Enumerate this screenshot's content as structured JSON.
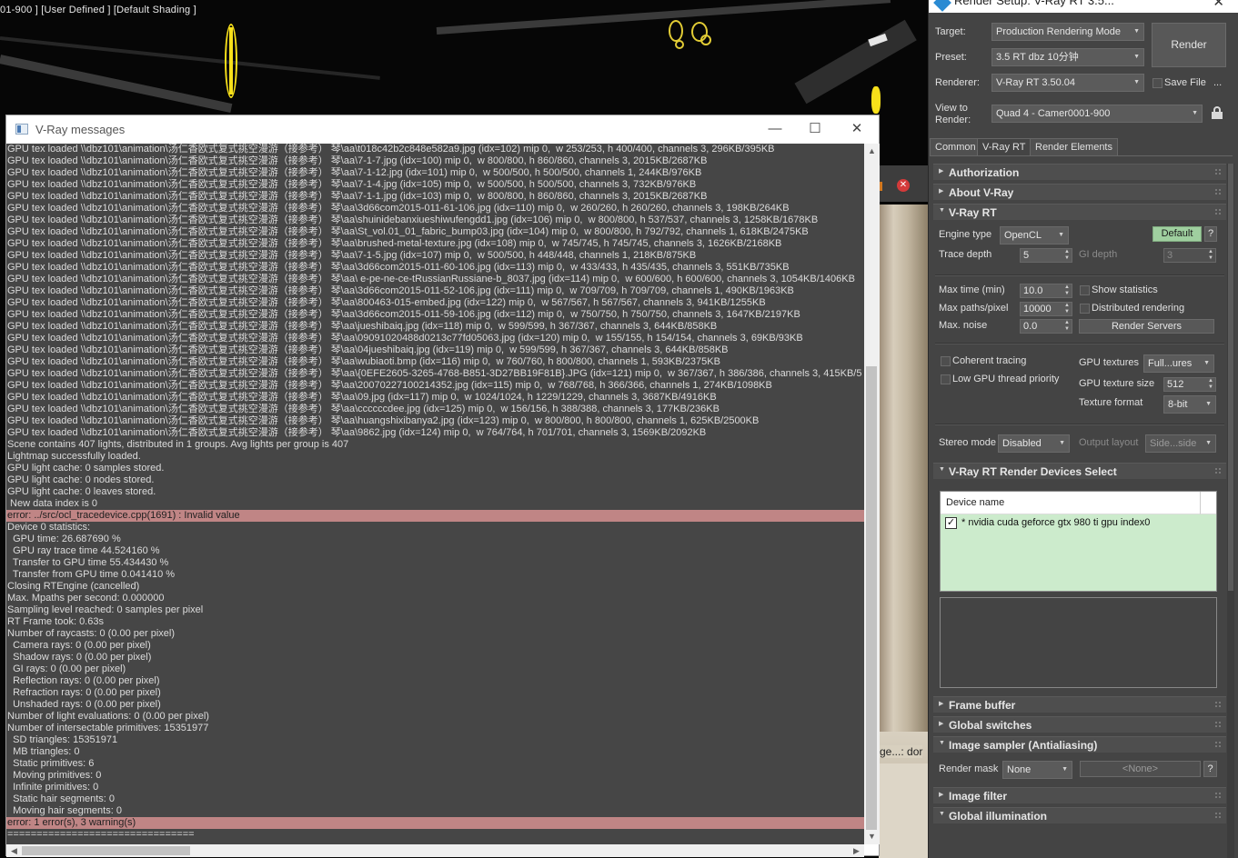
{
  "viewport": {
    "label": "01-900 ] [User Defined ] [Default Shading ]",
    "fragment_text": "ge...: dor"
  },
  "messages_window": {
    "title": "V-Ray messages",
    "lines": [
      {
        "text": "GPU tex loaded \\\\dbz101\\animation\\汤仁香欧式复式挑空漫游（接参考） 琴\\aa\\t018c42b2c848e582a9.jpg (idx=102) mip 0,  w 253/253, h 400/400, channels 3, 296KB/395KB",
        "error": false
      },
      {
        "text": "GPU tex loaded \\\\dbz101\\animation\\汤仁香欧式复式挑空漫游（接参考） 琴\\aa\\7-1-7.jpg (idx=100) mip 0,  w 800/800, h 860/860, channels 3, 2015KB/2687KB",
        "error": false
      },
      {
        "text": "GPU tex loaded \\\\dbz101\\animation\\汤仁香欧式复式挑空漫游（接参考） 琴\\aa\\7-1-12.jpg (idx=101) mip 0,  w 500/500, h 500/500, channels 1, 244KB/976KB",
        "error": false
      },
      {
        "text": "GPU tex loaded \\\\dbz101\\animation\\汤仁香欧式复式挑空漫游（接参考） 琴\\aa\\7-1-4.jpg (idx=105) mip 0,  w 500/500, h 500/500, channels 3, 732KB/976KB",
        "error": false
      },
      {
        "text": "GPU tex loaded \\\\dbz101\\animation\\汤仁香欧式复式挑空漫游（接参考） 琴\\aa\\7-1-1.jpg (idx=103) mip 0,  w 800/800, h 860/860, channels 3, 2015KB/2687KB",
        "error": false
      },
      {
        "text": "GPU tex loaded \\\\dbz101\\animation\\汤仁香欧式复式挑空漫游（接参考） 琴\\aa\\3d66com2015-011-61-106.jpg (idx=110) mip 0,  w 260/260, h 260/260, channels 3, 198KB/264KB",
        "error": false
      },
      {
        "text": "GPU tex loaded \\\\dbz101\\animation\\汤仁香欧式复式挑空漫游（接参考） 琴\\aa\\shuinidebanxiueshiwufengdd1.jpg (idx=106) mip 0,  w 800/800, h 537/537, channels 3, 1258KB/1678KB",
        "error": false
      },
      {
        "text": "GPU tex loaded \\\\dbz101\\animation\\汤仁香欧式复式挑空漫游（接参考） 琴\\aa\\St_vol.01_01_fabric_bump03.jpg (idx=104) mip 0,  w 800/800, h 792/792, channels 1, 618KB/2475KB",
        "error": false
      },
      {
        "text": "GPU tex loaded \\\\dbz101\\animation\\汤仁香欧式复式挑空漫游（接参考） 琴\\aa\\brushed-metal-texture.jpg (idx=108) mip 0,  w 745/745, h 745/745, channels 3, 1626KB/2168KB",
        "error": false
      },
      {
        "text": "GPU tex loaded \\\\dbz101\\animation\\汤仁香欧式复式挑空漫游（接参考） 琴\\aa\\7-1-5.jpg (idx=107) mip 0,  w 500/500, h 448/448, channels 1, 218KB/875KB",
        "error": false
      },
      {
        "text": "GPU tex loaded \\\\dbz101\\animation\\汤仁香欧式复式挑空漫游（接参考） 琴\\aa\\3d66com2015-011-60-106.jpg (idx=113) mip 0,  w 433/433, h 435/435, channels 3, 551KB/735KB",
        "error": false
      },
      {
        "text": "GPU tex loaded \\\\dbz101\\animation\\汤仁香欧式复式挑空漫游（接参考） 琴\\aa\\ e-pe-ne-ce-tRussianRussiane-b_8037.jpg (idx=114) mip 0,  w 600/600, h 600/600, channels 3, 1054KB/1406KB",
        "error": false
      },
      {
        "text": "GPU tex loaded \\\\dbz101\\animation\\汤仁香欧式复式挑空漫游（接参考） 琴\\aa\\3d66com2015-011-52-106.jpg (idx=111) mip 0,  w 709/709, h 709/709, channels 1, 490KB/1963KB",
        "error": false
      },
      {
        "text": "GPU tex loaded \\\\dbz101\\animation\\汤仁香欧式复式挑空漫游（接参考） 琴\\aa\\800463-015-embed.jpg (idx=122) mip 0,  w 567/567, h 567/567, channels 3, 941KB/1255KB",
        "error": false
      },
      {
        "text": "GPU tex loaded \\\\dbz101\\animation\\汤仁香欧式复式挑空漫游（接参考） 琴\\aa\\3d66com2015-011-59-106.jpg (idx=112) mip 0,  w 750/750, h 750/750, channels 3, 1647KB/2197KB",
        "error": false
      },
      {
        "text": "GPU tex loaded \\\\dbz101\\animation\\汤仁香欧式复式挑空漫游（接参考） 琴\\aa\\jueshibaiq.jpg (idx=118) mip 0,  w 599/599, h 367/367, channels 3, 644KB/858KB",
        "error": false
      },
      {
        "text": "GPU tex loaded \\\\dbz101\\animation\\汤仁香欧式复式挑空漫游（接参考） 琴\\aa\\09091020488d0213c77fd05063.jpg (idx=120) mip 0,  w 155/155, h 154/154, channels 3, 69KB/93KB",
        "error": false
      },
      {
        "text": "GPU tex loaded \\\\dbz101\\animation\\汤仁香欧式复式挑空漫游（接参考） 琴\\aa\\04jueshibaiq.jpg (idx=119) mip 0,  w 599/599, h 367/367, channels 3, 644KB/858KB",
        "error": false
      },
      {
        "text": "GPU tex loaded \\\\dbz101\\animation\\汤仁香欧式复式挑空漫游（接参考） 琴\\aa\\wubiaoti.bmp (idx=116) mip 0,  w 760/760, h 800/800, channels 1, 593KB/2375KB",
        "error": false
      },
      {
        "text": "GPU tex loaded \\\\dbz101\\animation\\汤仁香欧式复式挑空漫游（接参考） 琴\\aa\\{0EFE2605-3265-4768-B851-3D27BB19F81B}.JPG (idx=121) mip 0,  w 367/367, h 386/386, channels 3, 415KB/5",
        "error": false
      },
      {
        "text": "GPU tex loaded \\\\dbz101\\animation\\汤仁香欧式复式挑空漫游（接参考） 琴\\aa\\20070227100214352.jpg (idx=115) mip 0,  w 768/768, h 366/366, channels 1, 274KB/1098KB",
        "error": false
      },
      {
        "text": "GPU tex loaded \\\\dbz101\\animation\\汤仁香欧式复式挑空漫游（接参考） 琴\\aa\\09.jpg (idx=117) mip 0,  w 1024/1024, h 1229/1229, channels 3, 3687KB/4916KB",
        "error": false
      },
      {
        "text": "GPU tex loaded \\\\dbz101\\animation\\汤仁香欧式复式挑空漫游（接参考） 琴\\aa\\ccccccdee.jpg (idx=125) mip 0,  w 156/156, h 388/388, channels 3, 177KB/236KB",
        "error": false
      },
      {
        "text": "GPU tex loaded \\\\dbz101\\animation\\汤仁香欧式复式挑空漫游（接参考） 琴\\aa\\huangshixibanya2.jpg (idx=123) mip 0,  w 800/800, h 800/800, channels 1, 625KB/2500KB",
        "error": false
      },
      {
        "text": "GPU tex loaded \\\\dbz101\\animation\\汤仁香欧式复式挑空漫游（接参考） 琴\\aa\\9862.jpg (idx=124) mip 0,  w 764/764, h 701/701, channels 3, 1569KB/2092KB",
        "error": false
      },
      {
        "text": "Scene contains 407 lights, distributed in 1 groups. Avg lights per group is 407",
        "error": false
      },
      {
        "text": "Lightmap successfully loaded.",
        "error": false
      },
      {
        "text": "GPU light cache: 0 samples stored.",
        "error": false
      },
      {
        "text": "GPU light cache: 0 nodes stored.",
        "error": false
      },
      {
        "text": "GPU light cache: 0 leaves stored.",
        "error": false
      },
      {
        "text": " New data index is 0",
        "error": false
      },
      {
        "text": "error: ../src/ocl_tracedevice.cpp(1691) : Invalid value",
        "error": true
      },
      {
        "text": "Device 0 statistics:",
        "error": false
      },
      {
        "text": "  GPU time: 26.687690 %",
        "error": false
      },
      {
        "text": "  GPU ray trace time 44.524160 %",
        "error": false
      },
      {
        "text": "  Transfer to GPU time 55.434430 %",
        "error": false
      },
      {
        "text": "  Transfer from GPU time 0.041410 %",
        "error": false
      },
      {
        "text": "Closing RTEngine (cancelled)",
        "error": false
      },
      {
        "text": "Max. Mpaths per second: 0.000000",
        "error": false
      },
      {
        "text": "Sampling level reached: 0 samples per pixel",
        "error": false
      },
      {
        "text": "RT Frame took: 0.63s",
        "error": false
      },
      {
        "text": "Number of raycasts: 0 (0.00 per pixel)",
        "error": false
      },
      {
        "text": "  Camera rays: 0 (0.00 per pixel)",
        "error": false
      },
      {
        "text": "  Shadow rays: 0 (0.00 per pixel)",
        "error": false
      },
      {
        "text": "  GI rays: 0 (0.00 per pixel)",
        "error": false
      },
      {
        "text": "  Reflection rays: 0 (0.00 per pixel)",
        "error": false
      },
      {
        "text": "  Refraction rays: 0 (0.00 per pixel)",
        "error": false
      },
      {
        "text": "  Unshaded rays: 0 (0.00 per pixel)",
        "error": false
      },
      {
        "text": "Number of light evaluations: 0 (0.00 per pixel)",
        "error": false
      },
      {
        "text": "Number of intersectable primitives: 15351977",
        "error": false
      },
      {
        "text": "  SD triangles: 15351971",
        "error": false
      },
      {
        "text": "  MB triangles: 0",
        "error": false
      },
      {
        "text": "  Static primitives: 6",
        "error": false
      },
      {
        "text": "  Moving primitives: 0",
        "error": false
      },
      {
        "text": "  Infinite primitives: 0",
        "error": false
      },
      {
        "text": "  Static hair segments: 0",
        "error": false
      },
      {
        "text": "  Moving hair segments: 0",
        "error": false
      },
      {
        "text": "error: 1 error(s), 3 warning(s)",
        "error": true
      },
      {
        "text": "================================",
        "error": false
      }
    ]
  },
  "render_setup": {
    "title": "Render Setup: V-Ray RT 3.5...",
    "target_label": "Target:",
    "target_value": "Production Rendering Mode",
    "preset_label": "Preset:",
    "preset_value": "3.5  RT dbz 10分钟",
    "renderer_label": "Renderer:",
    "renderer_value": "V-Ray RT 3.50.04",
    "view_label": "View to\nRender:",
    "view_value": "Quad 4 - Camer0001-900",
    "render_button": "Render",
    "save_file_label": "Save File",
    "ellipsis": "...",
    "tabs": [
      "Common",
      "V-Ray RT",
      "Render Elements"
    ],
    "rollouts": {
      "authorization": "Authorization",
      "about": "About V-Ray",
      "vray_rt": "V-Ray RT",
      "devices": "V-Ray RT Render Devices Select",
      "frame_buffer": "Frame buffer",
      "global_switches": "Global switches",
      "image_sampler": "Image sampler (Antialiasing)",
      "image_filter": "Image filter",
      "global_illumination": "Global illumination"
    },
    "engine_type_label": "Engine type",
    "engine_type_value": "OpenCL",
    "default_button": "Default",
    "help_button": "?",
    "trace_depth_label": "Trace depth",
    "trace_depth_value": "5",
    "gi_depth_label": "GI depth",
    "gi_depth_value": "3",
    "max_time_label": "Max time (min)",
    "max_time_value": "10.0",
    "show_statistics_label": "Show statistics",
    "max_paths_label": "Max paths/pixel",
    "max_paths_value": "10000",
    "distributed_label": "Distributed rendering",
    "max_noise_label": "Max. noise",
    "max_noise_value": "0.0",
    "render_servers_button": "Render Servers",
    "coherent_label": "Coherent tracing",
    "low_priority_label": "Low GPU thread priority",
    "gpu_textures_label": "GPU textures",
    "gpu_textures_value": "Full...ures",
    "gpu_texture_size_label": "GPU texture size",
    "gpu_texture_size_value": "512",
    "texture_format_label": "Texture format",
    "texture_format_value": "8-bit",
    "stereo_mode_label": "Stereo mode",
    "stereo_mode_value": "Disabled",
    "output_layout_label": "Output layout",
    "output_layout_value": "Side...side",
    "device_column": "Device name",
    "device_name": "* nvidia cuda geforce gtx 980 ti gpu index0",
    "device_checked": "✓",
    "render_mask_label": "Render mask",
    "render_mask_value": "None",
    "render_mask_object": "<None>",
    "render_mask_help": "?"
  }
}
